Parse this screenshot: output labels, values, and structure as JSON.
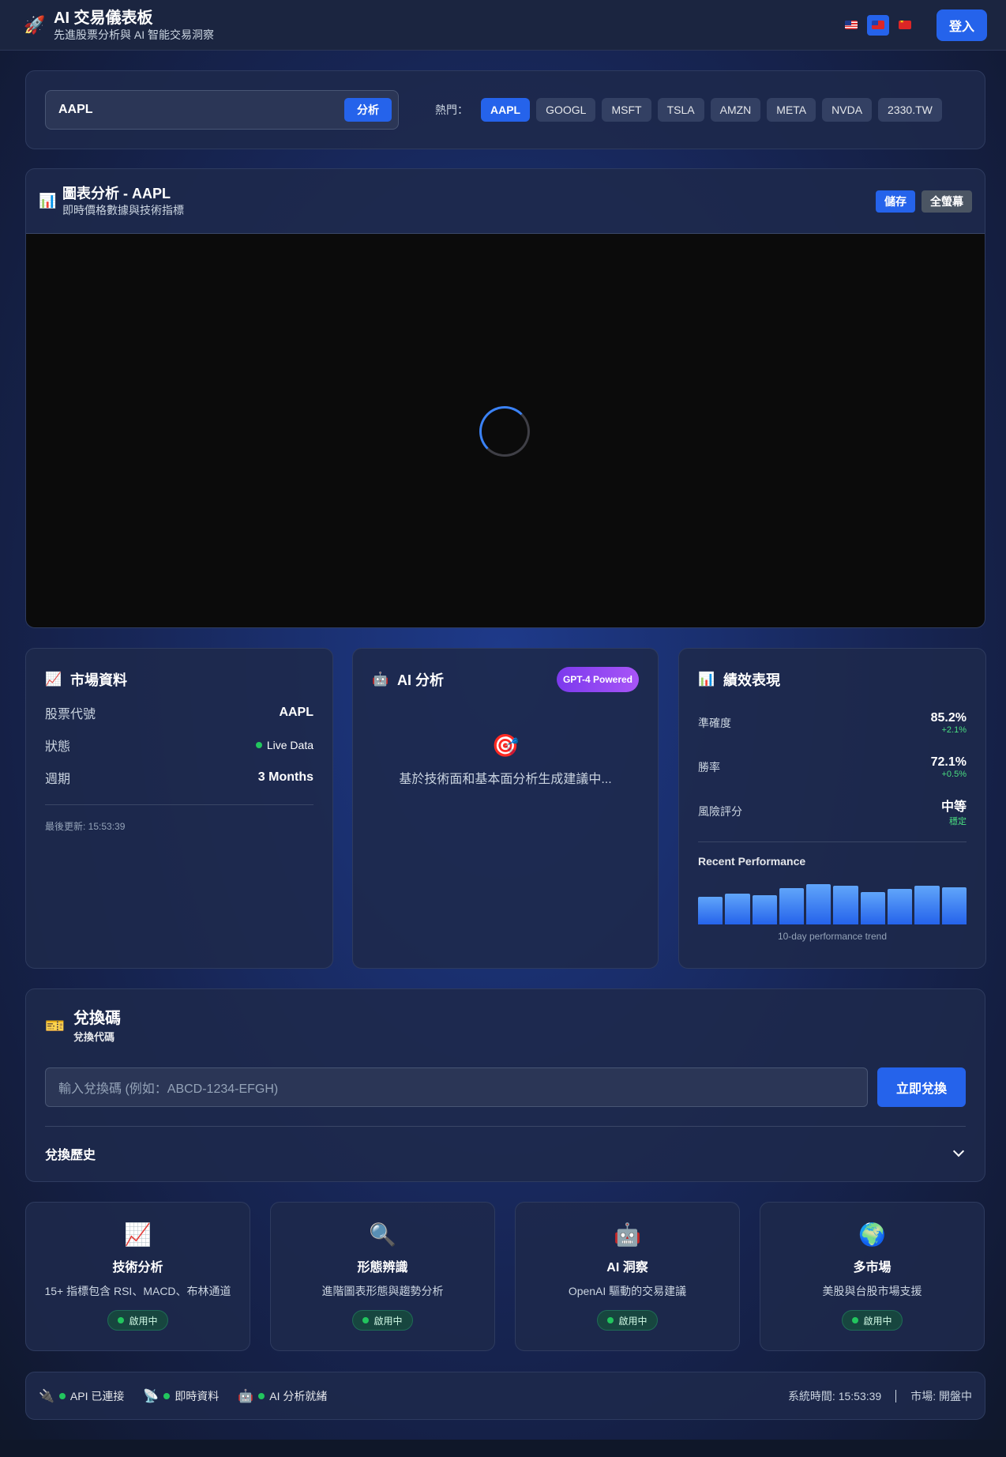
{
  "header": {
    "title": "AI 交易儀表板",
    "subtitle": "先進股票分析與 AI 智能交易洞察",
    "logo_icon": "rocket-icon",
    "languages": [
      {
        "code": "en",
        "flag": "us-flag-icon",
        "active": false
      },
      {
        "code": "zh-TW",
        "flag": "tw-flag-icon",
        "active": true
      },
      {
        "code": "zh-CN",
        "flag": "cn-flag-icon",
        "active": false
      }
    ],
    "login_label": "登入"
  },
  "search": {
    "value": "AAPL",
    "analyze_label": "分析",
    "hot_label": "熱門：",
    "hot_symbols": [
      "AAPL",
      "GOOGL",
      "MSFT",
      "TSLA",
      "AMZN",
      "META",
      "NVDA",
      "2330.TW"
    ],
    "active_symbol": "AAPL"
  },
  "chart": {
    "title": "圖表分析 - AAPL",
    "subtitle": "即時價格數據與技術指標",
    "save_label": "儲存",
    "fullscreen_label": "全螢幕",
    "loading": true
  },
  "market": {
    "title": "市場資料",
    "rows": [
      {
        "label": "股票代號",
        "value": "AAPL"
      },
      {
        "label": "狀態",
        "value": "Live Data"
      },
      {
        "label": "週期",
        "value": "3 Months"
      }
    ],
    "last_updated": "最後更新: 15:53:39"
  },
  "ai": {
    "title": "AI 分析",
    "badge": "GPT-4 Powered",
    "message": "基於技術面和基本面分析生成建議中..."
  },
  "performance": {
    "title": "績效表現",
    "metrics": [
      {
        "label": "準確度",
        "value": "85.2%",
        "delta": "+2.1%"
      },
      {
        "label": "勝率",
        "value": "72.1%",
        "delta": "+0.5%"
      },
      {
        "label": "風險評分",
        "value": "中等",
        "delta": "穩定"
      }
    ],
    "recent_label": "Recent Performance",
    "recent_bars": [
      0.58,
      0.65,
      0.61,
      0.77,
      0.85,
      0.81,
      0.69,
      0.75,
      0.82,
      0.79
    ],
    "trend_label": "10-day performance trend"
  },
  "redeem": {
    "title": "兌換碼",
    "subtitle": "兌換代碼",
    "placeholder": "輸入兌換碼 (例如：ABCD-1234-EFGH)",
    "button_label": "立即兌換",
    "history_label": "兌換歷史"
  },
  "features": [
    {
      "icon": "chart-up-icon",
      "title": "技術分析",
      "desc": "15+ 指標包含 RSI、MACD、布林通道",
      "status": "啟用中"
    },
    {
      "icon": "magnifier-icon",
      "title": "形態辨識",
      "desc": "進階圖表形態與趨勢分析",
      "status": "啟用中"
    },
    {
      "icon": "robot-icon",
      "title": "AI 洞察",
      "desc": "OpenAI 驅動的交易建議",
      "status": "啟用中"
    },
    {
      "icon": "globe-icon",
      "title": "多市場",
      "desc": "美股與台股市場支援",
      "status": "啟用中"
    }
  ],
  "status": {
    "items": [
      {
        "icon": "plug-icon",
        "label": "API 已連接"
      },
      {
        "icon": "satellite-icon",
        "label": "即時資料"
      },
      {
        "icon": "robot-icon",
        "label": "AI 分析就緒"
      }
    ],
    "system_time": "系統時間: 15:53:39",
    "market": "市場: 開盤中"
  },
  "colors": {
    "accent": "#2563eb",
    "success": "#22c55e",
    "badge_purple": "#7c3aed"
  }
}
